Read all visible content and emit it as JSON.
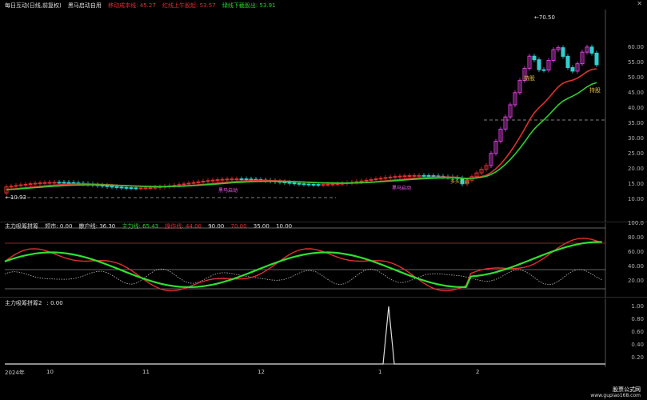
{
  "main": {
    "title": "每日互动(日线,前复权)",
    "indicator": "黑马启动自用",
    "legend": [
      {
        "label": "移动成本线: 45.27",
        "color": "#e03030"
      },
      {
        "label": "红线上牛股起: 53.57",
        "color": "#e03030"
      },
      {
        "label": "绿线下截股出: 53.91",
        "color": "#30d030"
      }
    ],
    "price_labels": {
      "high": "70.50",
      "low": "10.93"
    },
    "axis": [
      "60.00",
      "55.00",
      "50.00",
      "45.00",
      "40.00",
      "35.00",
      "30.00",
      "25.00",
      "20.00",
      "15.00",
      "10.00"
    ],
    "signal_labels": [
      "持股",
      "持股",
      "黑马启动",
      "黑马启动",
      "多头开启"
    ]
  },
  "osc1": {
    "title": "主力吸筹拼筹",
    "legend": [
      {
        "label": "短市: 0.00",
        "color": "#e0e0e0"
      },
      {
        "label": "散户线: 36.30",
        "color": "#e0e0e0"
      },
      {
        "label": "主力线: 65.43",
        "color": "#30d030"
      },
      {
        "label": "操作线: 44.00",
        "color": "#e03030"
      },
      {
        "label": "90.00",
        "color": "#e0e0e0"
      },
      {
        "label": "70.00",
        "color": "#e03030"
      },
      {
        "label": "35.00",
        "color": "#e0e0e0"
      },
      {
        "label": "10.00",
        "color": "#e0e0e0"
      }
    ],
    "axis": [
      "100.0",
      "80.00",
      "60.00",
      "40.00",
      "20.00"
    ]
  },
  "osc2": {
    "title": "主力吸筹拼筹2",
    "value": "0.00",
    "axis": [
      "1.00",
      "0.80",
      "0.60",
      "0.40",
      "0.20"
    ]
  },
  "xaxis": [
    "2024年",
    "10",
    "11",
    "12",
    "1",
    "2"
  ],
  "watermark": {
    "line1": "股票公式网",
    "line2": "www.gupiao168.com"
  },
  "chart_data": [
    {
      "type": "candlestick",
      "title": "每日互动(日线,前复权)",
      "ylim": [
        10,
        65
      ],
      "series": [
        {
          "name": "移动成本线",
          "values": [
            45.27
          ]
        },
        {
          "name": "红线上牛股起",
          "values": [
            53.57
          ]
        },
        {
          "name": "绿线下截股出",
          "values": [
            53.91
          ]
        }
      ],
      "annotations": [
        "70.50",
        "10.93"
      ]
    },
    {
      "type": "line",
      "title": "主力吸筹拼筹",
      "ylim": [
        0,
        100
      ],
      "series": [
        {
          "name": "散户线",
          "values": [
            36.3
          ]
        },
        {
          "name": "主力线",
          "values": [
            65.43
          ]
        },
        {
          "name": "操作线",
          "values": [
            44.0
          ]
        }
      ]
    },
    {
      "type": "line",
      "title": "主力吸筹拼筹2",
      "ylim": [
        0,
        1
      ],
      "series": [
        {
          "name": "主力吸筹拼筹2",
          "values": [
            0.0
          ]
        }
      ]
    }
  ]
}
